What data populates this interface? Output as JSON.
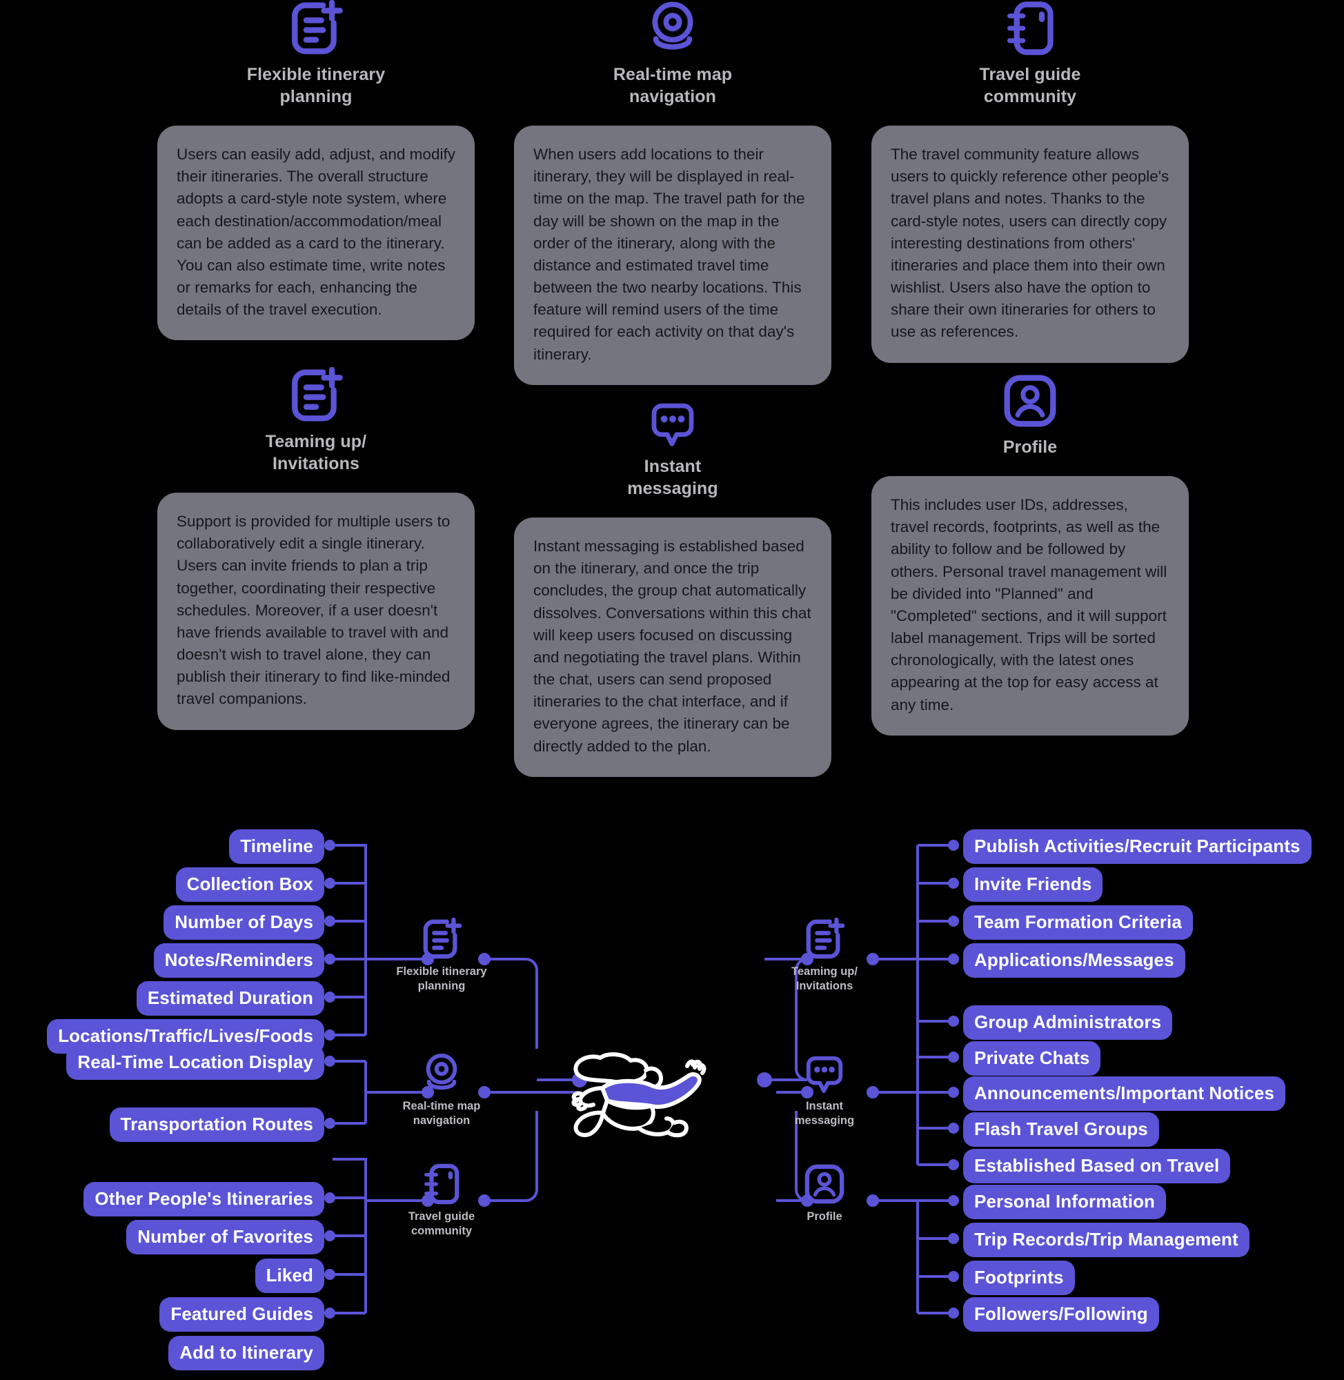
{
  "accent": "#5b54d6",
  "card_bg": "#75757f",
  "background": "#000000",
  "features": [
    {
      "icon": "note-add-icon",
      "title": "Flexible itinerary\nplanning",
      "body": "Users can easily add, adjust, and modify their itineraries. The overall structure adopts a card-style note system, where each destination/accommodation/meal can be added as a card to the itinerary. You can also estimate time, write notes or remarks for each, enhancing the details of the travel execution."
    },
    {
      "icon": "map-pin-icon",
      "title": "Real-time map\nnavigation",
      "body": "When users add locations to their itinerary, they will be displayed in real-time on the map. The travel path for the day will be shown on the map in the order of the itinerary, along with the distance and estimated travel time between the two nearby locations. This feature will remind users of the time required for each activity on that day's itinerary."
    },
    {
      "icon": "notebook-icon",
      "title": "Travel guide\ncommunity",
      "body": "The travel community feature allows users to quickly reference other people's travel plans and notes. Thanks to the card-style notes, users can directly copy interesting destinations from others' itineraries and place them into their own wishlist. Users also have the option to share their own itineraries for others to use as references."
    },
    {
      "icon": "note-add-icon",
      "title": "Teaming up/\nInvitations",
      "body": "Support is provided for multiple users to collaboratively edit a single itinerary. Users can invite friends to plan a trip together, coordinating their respective schedules. Moreover, if a user doesn't have friends available to travel with and doesn't wish to travel alone, they can publish their itinerary to find like-minded travel companions."
    },
    {
      "icon": "chat-bubble-icon",
      "title": "Instant\nmessaging",
      "body": "Instant messaging is established based on the itinerary, and once the trip concludes, the group chat automatically dissolves. Conversations within this chat will keep users focused on discussing and negotiating the travel plans. Within the chat, users can send proposed itineraries to the chat interface, and if everyone agrees, the itinerary can be directly added to the plan."
    },
    {
      "icon": "profile-icon",
      "title": "Profile",
      "body": "This includes user IDs, addresses, travel records, footprints, as well as the ability to follow and be followed by others. Personal travel management will be divided into \"Planned\" and \"Completed\" sections, and it will support label management. Trips will be sorted chronologically, with the latest ones appearing at the top for easy access at any time."
    }
  ],
  "mindmap": {
    "center_illustration": "running-person-illustration",
    "nodes": [
      {
        "icon": "note-add-icon",
        "label": "Flexible itinerary\nplanning"
      },
      {
        "icon": "map-pin-icon",
        "label": "Real-time map\nnavigation"
      },
      {
        "icon": "notebook-icon",
        "label": "Travel guide\ncommunity"
      },
      {
        "icon": "note-add-icon",
        "label": "Teaming up/\nInvitations"
      },
      {
        "icon": "chat-bubble-icon",
        "label": "Instant\nmessaging"
      },
      {
        "icon": "profile-icon",
        "label": "Profile"
      }
    ],
    "left_branches": [
      {
        "node": "Flexible itinerary planning",
        "items": [
          "Timeline",
          "Collection Box",
          "Number of Days",
          "Notes/Reminders",
          "Estimated Duration",
          "Locations/Traffic/Lives/Foods"
        ]
      },
      {
        "node": "Real-time map navigation",
        "items": [
          "Real-Time Location Display",
          "Transportation Routes"
        ]
      },
      {
        "node": "Travel guide community",
        "items": [
          "Other People's Itineraries",
          "Number of Favorites",
          "Liked",
          "Featured Guides",
          "Add to Itinerary"
        ]
      }
    ],
    "right_branches": [
      {
        "node": "Teaming up/Invitations",
        "items": [
          "Publish Activities/Recruit Participants",
          "Invite Friends",
          "Team Formation Criteria",
          "Applications/Messages"
        ]
      },
      {
        "node": "Instant messaging",
        "items": [
          "Group Administrators",
          "Private Chats",
          "Announcements/Important Notices",
          "Flash Travel Groups",
          "Established Based on Travel"
        ]
      },
      {
        "node": "Profile",
        "items": [
          "Personal Information",
          "Trip Records/Trip Management",
          "Footprints",
          "Followers/Following"
        ]
      }
    ]
  }
}
